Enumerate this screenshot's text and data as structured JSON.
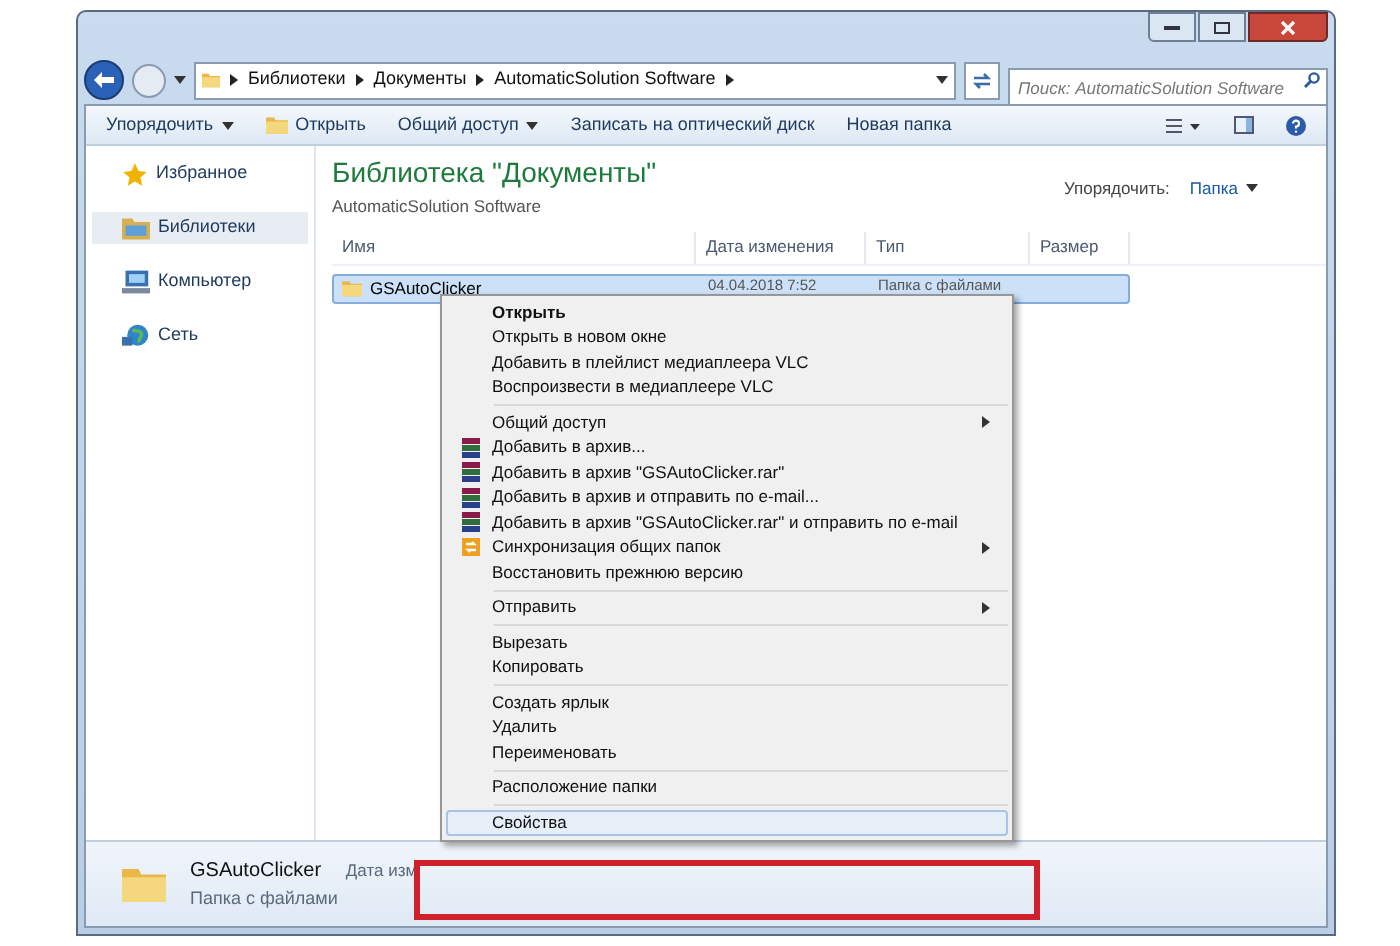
{
  "address": {
    "path": [
      "Библиотеки",
      "Документы",
      "AutomaticSolution Software"
    ]
  },
  "search": {
    "placeholder": "Поиск: AutomaticSolution Software"
  },
  "toolbar": [
    {
      "label": "Упорядочить",
      "kind": "dropdown"
    },
    {
      "label": "Открыть",
      "kind": "open"
    },
    {
      "label": "Общий доступ",
      "kind": "dropdown"
    },
    {
      "label": "Записать на оптический диск",
      "kind": "plain"
    },
    {
      "label": "Новая папка",
      "kind": "plain"
    }
  ],
  "sidebar": {
    "items": [
      {
        "label": "Избранное",
        "kind": "star",
        "selected": false
      },
      {
        "label": "Библиотеки",
        "kind": "library",
        "selected": true
      },
      {
        "label": "Компьютер",
        "kind": "computer",
        "selected": false
      },
      {
        "label": "Сеть",
        "kind": "network",
        "selected": false
      }
    ]
  },
  "library": {
    "title": "Библиотека \"Документы\"",
    "subtitle": "AutomaticSolution Software",
    "arrange_label": "Упорядочить:",
    "arrange_value": "Папка"
  },
  "table": {
    "columns": [
      "Имя",
      "Дата изменения",
      "Тип",
      "Размер"
    ],
    "rows": [
      {
        "name": "GSAutoClicker",
        "date": "04.04.2018 7:52",
        "type": "Папка с файлами",
        "selected": true
      }
    ]
  },
  "context_menu": {
    "groups": [
      [
        {
          "label": "Открыть",
          "bold": true,
          "kind": "none",
          "submenu": false,
          "selected": false
        },
        {
          "label": "Открыть в новом окне",
          "bold": false,
          "kind": "none",
          "submenu": false,
          "selected": false
        },
        {
          "label": "Добавить в плейлист медиаплеера VLC",
          "bold": false,
          "kind": "none",
          "submenu": false,
          "selected": false
        },
        {
          "label": "Воспроизвести в медиаплеере VLC",
          "bold": false,
          "kind": "none",
          "submenu": false,
          "selected": false
        }
      ],
      [
        {
          "label": "Общий доступ",
          "bold": false,
          "kind": "none",
          "submenu": true,
          "selected": false
        },
        {
          "label": "Добавить в архив...",
          "bold": false,
          "kind": "archive",
          "submenu": false,
          "selected": false
        },
        {
          "label": "Добавить в архив \"GSAutoClicker.rar\"",
          "bold": false,
          "kind": "archive",
          "submenu": false,
          "selected": false
        },
        {
          "label": "Добавить в архив и отправить по e-mail...",
          "bold": false,
          "kind": "archive",
          "submenu": false,
          "selected": false
        },
        {
          "label": "Добавить в архив \"GSAutoClicker.rar\" и отправить по e-mail",
          "bold": false,
          "kind": "archive",
          "submenu": false,
          "selected": false
        },
        {
          "label": "Синхронизация общих папок",
          "bold": false,
          "kind": "sync",
          "submenu": true,
          "selected": false
        },
        {
          "label": "Восстановить прежнюю версию",
          "bold": false,
          "kind": "none",
          "submenu": false,
          "selected": false
        }
      ],
      [
        {
          "label": "Отправить",
          "bold": false,
          "kind": "none",
          "submenu": true,
          "selected": false
        }
      ],
      [
        {
          "label": "Вырезать",
          "bold": false,
          "kind": "none",
          "submenu": false,
          "selected": false
        },
        {
          "label": "Копировать",
          "bold": false,
          "kind": "none",
          "submenu": false,
          "selected": false
        }
      ],
      [
        {
          "label": "Создать ярлык",
          "bold": false,
          "kind": "none",
          "submenu": false,
          "selected": false
        },
        {
          "label": "Удалить",
          "bold": false,
          "kind": "none",
          "submenu": false,
          "selected": false
        },
        {
          "label": "Переименовать",
          "bold": false,
          "kind": "none",
          "submenu": false,
          "selected": false
        }
      ],
      [
        {
          "label": "Расположение папки",
          "bold": false,
          "kind": "none",
          "submenu": false,
          "selected": false
        }
      ],
      [
        {
          "label": "Свойства",
          "bold": false,
          "kind": "none",
          "submenu": false,
          "selected": true
        }
      ]
    ]
  },
  "details": {
    "name": "GSAutoClicker",
    "type": "Папка с файлами",
    "date_label": "Дата изм"
  }
}
